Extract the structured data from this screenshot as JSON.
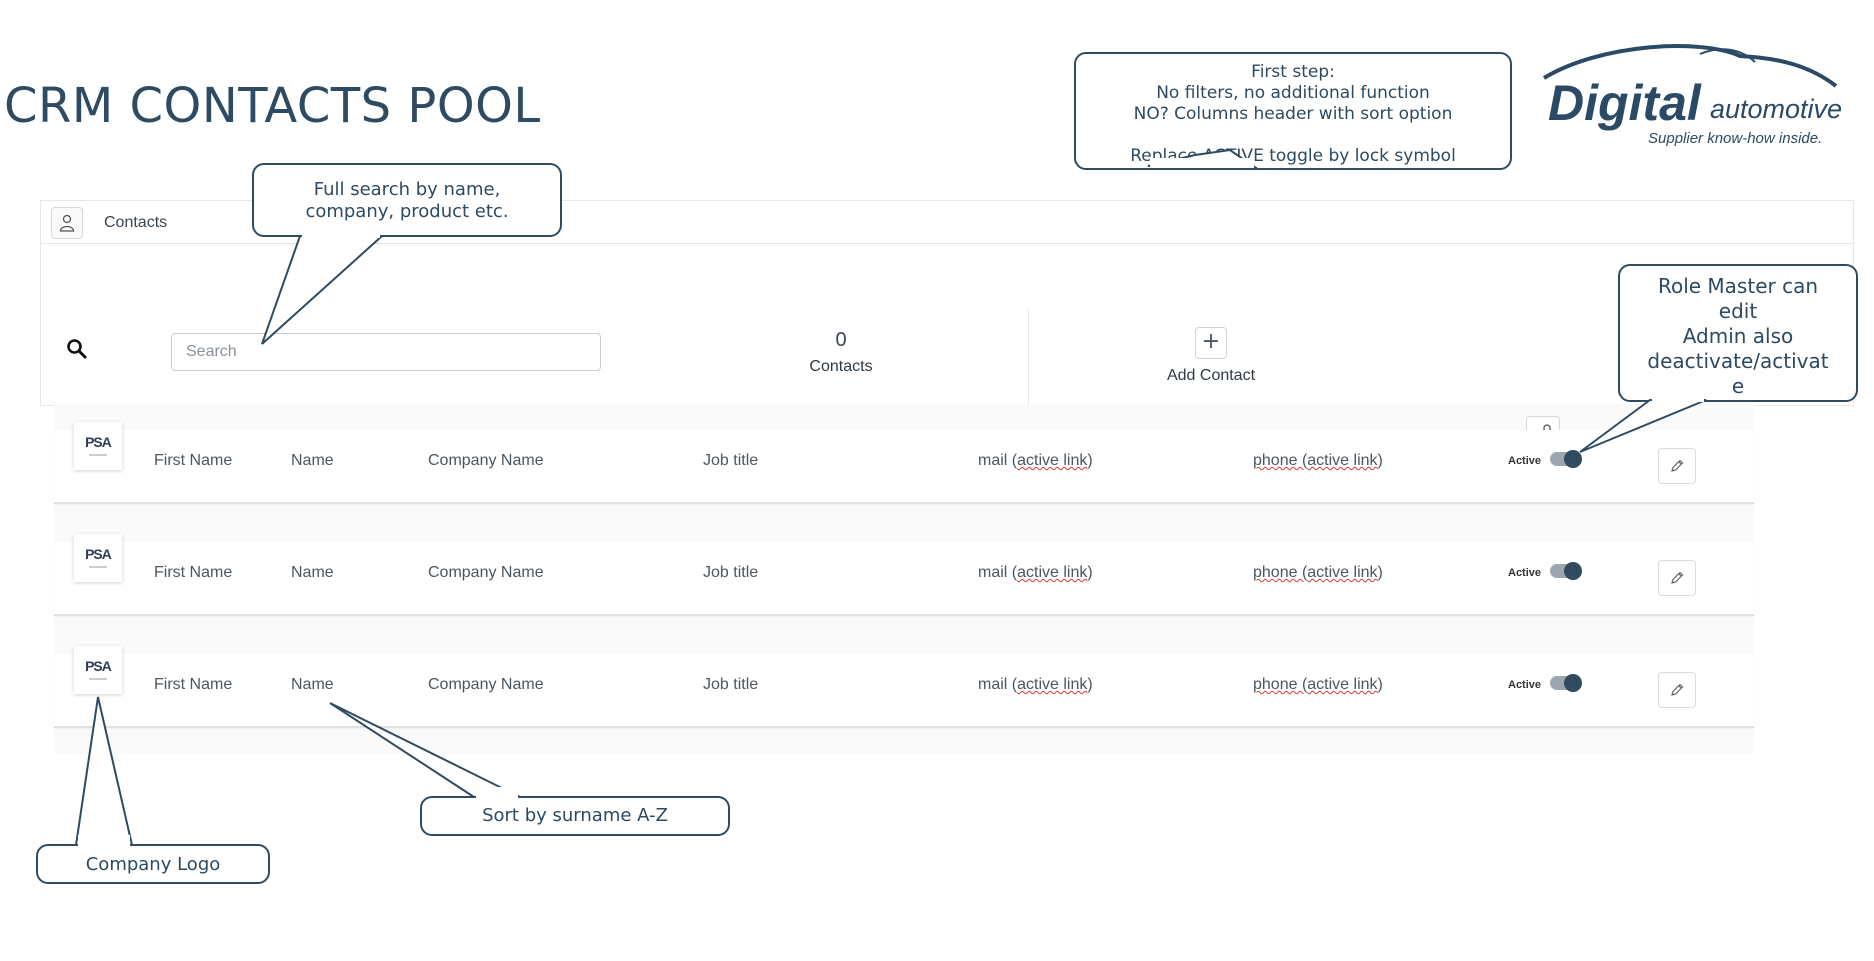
{
  "page": {
    "title": "CRM CONTACTS POOL"
  },
  "logo": {
    "brand": "Digital",
    "brand_suffix": "automotive",
    "tagline": "Supplier know-how inside."
  },
  "panel": {
    "header_label": "Contacts",
    "search_placeholder": "Search",
    "contacts_count": "0",
    "contacts_label": "Contacts",
    "add_icon": "+",
    "add_label": "Add Contact"
  },
  "rows": [
    {
      "logo_text": "PSA",
      "first_name": "First Name",
      "name": "Name",
      "company": "Company Name",
      "job": "Job title",
      "mail_prefix": "mail (",
      "mail_link": "active link",
      "mail_suffix": ")",
      "phone_prefix": "phone (",
      "phone_link": "active link",
      "phone_suffix": ")",
      "status": "Active"
    },
    {
      "logo_text": "PSA",
      "first_name": "First Name",
      "name": "Name",
      "company": "Company Name",
      "job": "Job title",
      "mail_prefix": "mail (",
      "mail_link": "active link",
      "mail_suffix": ")",
      "phone_prefix": "phone (",
      "phone_link": "active link",
      "phone_suffix": ")",
      "status": "Active"
    },
    {
      "logo_text": "PSA",
      "first_name": "First Name",
      "name": "Name",
      "company": "Company Name",
      "job": "Job title",
      "mail_prefix": "mail (",
      "mail_link": "active link",
      "mail_suffix": ")",
      "phone_prefix": "phone (",
      "phone_link": "active link",
      "phone_suffix": ")",
      "status": "Active"
    }
  ],
  "callouts": {
    "first_step": [
      "First step:",
      "No filters, no additional function",
      "NO? Columns header with sort option",
      "",
      "Replace ACTIVE toggle by lock symbol"
    ],
    "full_search": [
      "Full search by name,",
      "company, product etc."
    ],
    "role_master": [
      "Role Master can",
      "edit",
      "Admin also",
      "deactivate/activat",
      "e"
    ],
    "sort": "Sort by surname A-Z",
    "company_logo": "Company Logo"
  },
  "icons": [
    "contact-person-icon",
    "search-icon",
    "plus-icon",
    "lock-open-icon",
    "pencil-icon",
    "toggle-switch"
  ],
  "colors": {
    "accent": "#2f4b62",
    "text": "#2c4a63",
    "border": "#e5e7ea",
    "wavy_underline": "#d23b3b"
  }
}
